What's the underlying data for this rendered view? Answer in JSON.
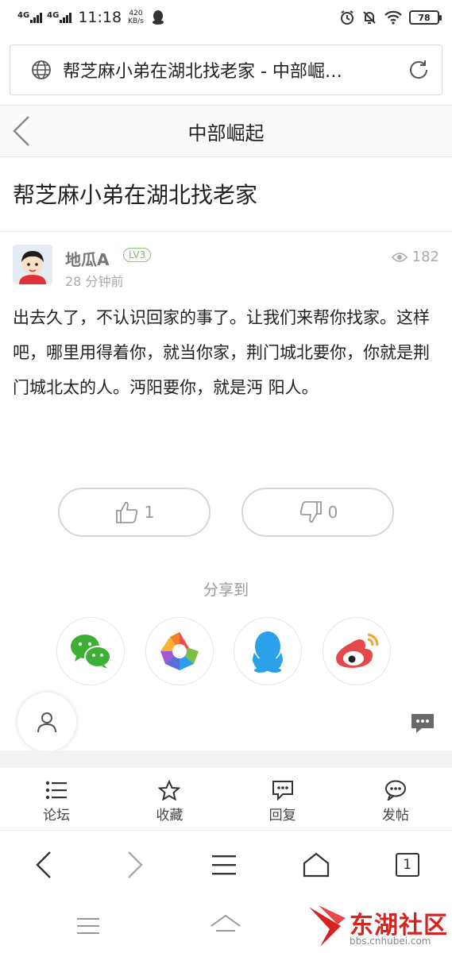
{
  "status_bar": {
    "network1": "4G",
    "network2": "4G",
    "time": "11:18",
    "speed_value": "420",
    "speed_unit": "KB/s",
    "battery": "78"
  },
  "address_bar": {
    "title": "帮芝麻小弟在湖北找老家 - 中部崛…"
  },
  "header": {
    "title": "中部崛起"
  },
  "post": {
    "title": "帮芝麻小弟在湖北找老家",
    "author": "地瓜A",
    "level": "LV3",
    "time": "28 分钟前",
    "views": "182",
    "body": "出去久了，不认识回家的事了。让我们来帮你找家。这样吧，哪里用得着你，就当你家，荆门城北要你，你就是荆门城北太的人。沔阳要你，就是沔 阳人。"
  },
  "votes": {
    "likes": "1",
    "dislikes": "0"
  },
  "share": {
    "label": "分享到",
    "targets": [
      "wechat-icon",
      "moments-icon",
      "qq-icon",
      "weibo-icon"
    ]
  },
  "bottom_tabs": [
    {
      "label": "论坛",
      "icon": "list-icon"
    },
    {
      "label": "收藏",
      "icon": "star-icon"
    },
    {
      "label": "回复",
      "icon": "comment-icon"
    },
    {
      "label": "发帖",
      "icon": "chat-bubble-icon"
    }
  ],
  "browser_nav": {
    "tab_count": "1"
  },
  "watermark": {
    "name": "东湖社区",
    "url": "bbs.cnhubei.com"
  },
  "colors": {
    "accent_red": "#d7231f",
    "level_green": "#7cb86a",
    "muted_gray": "#999999"
  }
}
